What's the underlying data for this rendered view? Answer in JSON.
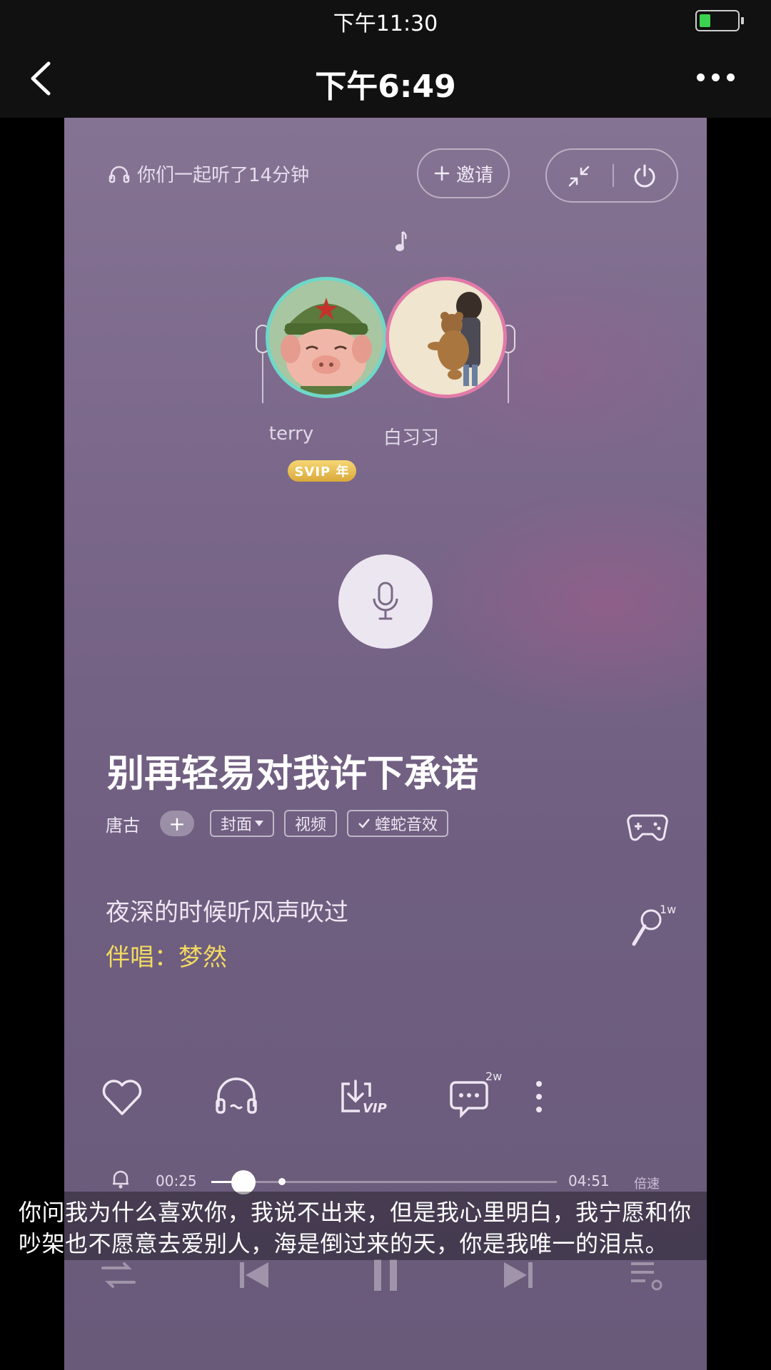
{
  "status_bar": {
    "time": "下午11:30",
    "battery_level": 0.3,
    "battery_color": "#3bd24f"
  },
  "nav": {
    "title": "下午6:49",
    "back_icon": "chevron-left-icon",
    "more_icon": "more-horizontal-icon"
  },
  "listen_together": {
    "info": "你们一起听了14分钟",
    "invite_label": "邀请",
    "users": [
      {
        "name": "terry",
        "badge": "SVIP 年"
      },
      {
        "name": "白习习"
      }
    ]
  },
  "song": {
    "title": "别再轻易对我许下承诺",
    "artist": "唐古",
    "follow_label": "+",
    "tags": [
      "封面",
      "视频",
      "蝰蛇音效"
    ]
  },
  "lyrics": {
    "line1": "夜深的时候听风声吹过",
    "line2": "伴唱：梦然",
    "sing_count": "1w"
  },
  "actions": {
    "comment_count": "2w",
    "download_badge": "VIP"
  },
  "progress": {
    "current": "00:25",
    "total": "04:51",
    "played_fraction": 0.094,
    "buffered_fraction": 0.205,
    "speed_label": "倍速"
  },
  "subtitle": {
    "line1": "你问我为什么喜欢你，我说不出来，但是我心里明白，我宁愿和你",
    "line2": "吵架也不愿意去爱别人，海是倒过来的天，你是我唯一的泪点。"
  },
  "colors": {
    "accent_lyric": "#f2da62",
    "frame_bg": "#7a678a",
    "svip_gold": "#e4b84b"
  }
}
